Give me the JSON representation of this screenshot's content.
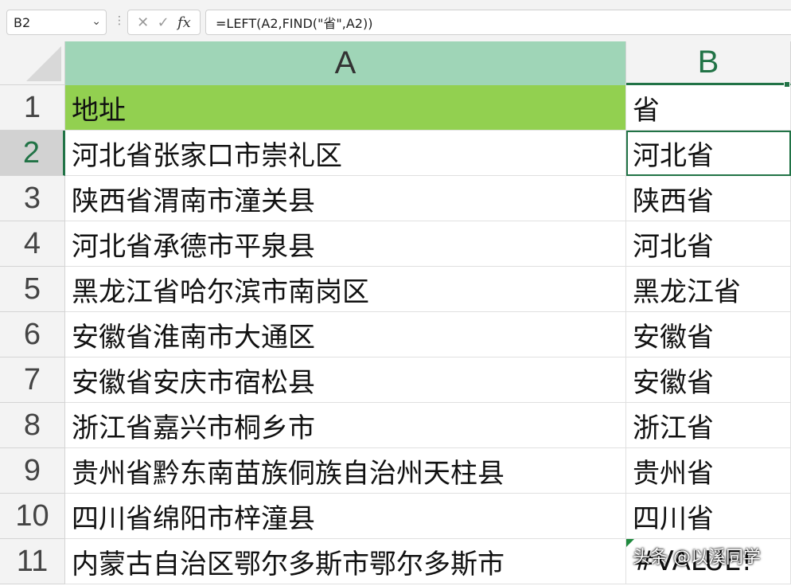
{
  "name_box": {
    "value": "B2"
  },
  "formula_bar": {
    "formula": "=LEFT(A2,FIND(\"省\",A2))",
    "fx_label": "fx"
  },
  "columns": [
    "A",
    "B"
  ],
  "rows": [
    {
      "num": "1",
      "a": "地址",
      "b": "省"
    },
    {
      "num": "2",
      "a": "河北省张家口市崇礼区",
      "b": "河北省"
    },
    {
      "num": "3",
      "a": "陕西省渭南市潼关县",
      "b": "陕西省"
    },
    {
      "num": "4",
      "a": "河北省承德市平泉县",
      "b": "河北省"
    },
    {
      "num": "5",
      "a": "黑龙江省哈尔滨市南岗区",
      "b": "黑龙江省"
    },
    {
      "num": "6",
      "a": "安徽省淮南市大通区",
      "b": "安徽省"
    },
    {
      "num": "7",
      "a": "安徽省安庆市宿松县",
      "b": "安徽省"
    },
    {
      "num": "8",
      "a": "浙江省嘉兴市桐乡市",
      "b": "浙江省"
    },
    {
      "num": "9",
      "a": "贵州省黔东南苗族侗族自治州天柱县",
      "b": "贵州省"
    },
    {
      "num": "10",
      "a": "四川省绵阳市梓潼县",
      "b": "四川省"
    },
    {
      "num": "11",
      "a": "内蒙古自治区鄂尔多斯市鄂尔多斯市",
      "b": "#VALUE!"
    }
  ],
  "watermark": "头条 @以溪同学",
  "colors": {
    "header_fill": "#92d050",
    "selected_col_header": "#9fd5b7",
    "accent": "#217346"
  }
}
